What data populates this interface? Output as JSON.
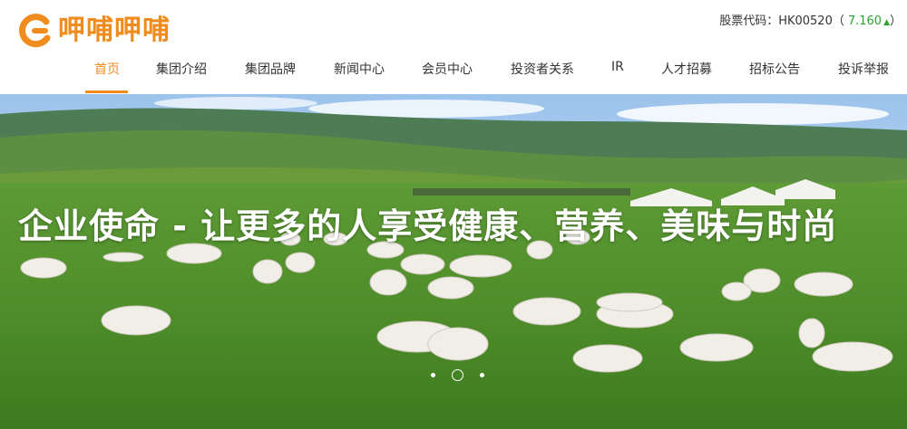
{
  "brand": {
    "logo_text": "呷哺呷哺",
    "accent_color": "#f08c1e"
  },
  "stock": {
    "label": "股票代码：HK00520（",
    "price": "7.160",
    "trend_icon": "▲",
    "close": "）",
    "price_color": "#2aa52a"
  },
  "nav": {
    "items": [
      {
        "label": "首页",
        "active": true
      },
      {
        "label": "集团介绍"
      },
      {
        "label": "集团品牌"
      },
      {
        "label": "新闻中心"
      },
      {
        "label": "会员中心"
      },
      {
        "label": "投资者关系"
      },
      {
        "label": "IR"
      },
      {
        "label": "人才招募"
      },
      {
        "label": "招标公告"
      },
      {
        "label": "投诉举报"
      }
    ]
  },
  "hero": {
    "slogan": "企业使命 - 让更多的人享受健康、营养、美味与时尚",
    "slide_count": 3,
    "active_slide": 2
  }
}
